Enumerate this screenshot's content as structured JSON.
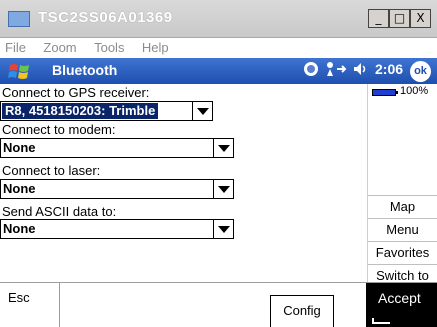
{
  "window": {
    "title": "TSC2SS06A01369",
    "minimize": "_",
    "maximize": "□",
    "close": "X"
  },
  "menu": [
    "File",
    "Zoom",
    "Tools",
    "Help"
  ],
  "taskbar": {
    "title": "Bluetooth",
    "time": "2:06",
    "ok": "ok"
  },
  "form": {
    "gps_label": "Connect to GPS receiver:",
    "gps_value": "R8, 4518150203: Trimble",
    "modem_label": "Connect to modem:",
    "modem_value": "None",
    "laser_label": "Connect to laser:",
    "laser_value": "None",
    "ascii_label": "Send ASCII data to:",
    "ascii_value": "None"
  },
  "status": {
    "battery": "100%"
  },
  "side": {
    "map": "Map",
    "menu": "Menu",
    "favorites": "Favorites",
    "switch_to": "Switch to"
  },
  "softkeys": {
    "esc": "Esc",
    "config": "Config",
    "accept": "Accept"
  },
  "colors": {
    "taskbar": "#2b5fc2",
    "selection": "#0a246a",
    "accept_bg": "#000000"
  }
}
